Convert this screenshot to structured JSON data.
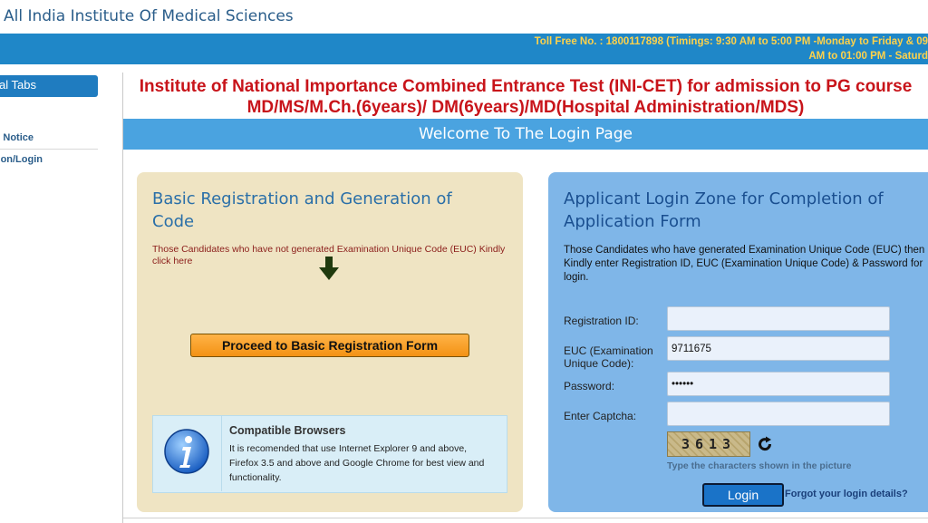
{
  "header": {
    "site_title": "All India Institute Of Medical Sciences",
    "toll_free_line1": "Toll Free No. : 1800117898 (Timings: 9:30 AM to 5:00 PM -Monday to Friday & 09",
    "toll_free_line2": "AM to 01:00 PM - Saturd"
  },
  "sidebar": {
    "tab_label": "al Tabs",
    "links": [
      {
        "label": "Notice"
      },
      {
        "label": "on/Login"
      }
    ]
  },
  "main": {
    "heading_line1": "Institute of National Importance Combined Entrance Test (INI-CET) for admission to PG course",
    "heading_line2": "MD/MS/M.Ch.(6years)/ DM(6years)/MD(Hospital Administration/MDS)",
    "welcome": "Welcome To The Login Page"
  },
  "registration": {
    "title": "Basic Registration and Generation of Code",
    "note": "Those Candidates who have not generated Examination Unique Code (EUC) Kindly click here",
    "button_label": "Proceed to Basic Registration Form"
  },
  "browsers": {
    "title": "Compatible Browsers",
    "text": "It is recomended that use Internet Explorer 9 and above, Firefox 3.5 and above and Google Chrome for best view and functionality."
  },
  "login": {
    "title": "Applicant Login Zone for Completion of Application Form",
    "note": "Those Candidates who have generated Examination Unique Code (EUC) then Kindly enter Registration ID, EUC (Examination Unique Code) & Password for login.",
    "label_regid": "Registration ID:",
    "label_euc": "EUC (Examination Unique Code):",
    "label_password": "Password:",
    "label_captcha": "Enter Captcha:",
    "value_regid": "",
    "value_euc": "9711675",
    "value_password": "••••••",
    "value_captcha": "",
    "captcha_text": "3613",
    "captcha_hint": "Type the characters shown in the picture",
    "login_button": "Login",
    "forgot_link": "Forgot your login details?"
  },
  "colors": {
    "top_bar": "#1f87c8",
    "heading_red": "#c8141a",
    "left_panel": "#efe4c3",
    "right_panel": "#7fb6e8",
    "proceed_button": "#f39214"
  },
  "icons": {
    "down_arrow": "arrow-down-icon",
    "info": "info-icon",
    "refresh": "refresh-icon"
  }
}
